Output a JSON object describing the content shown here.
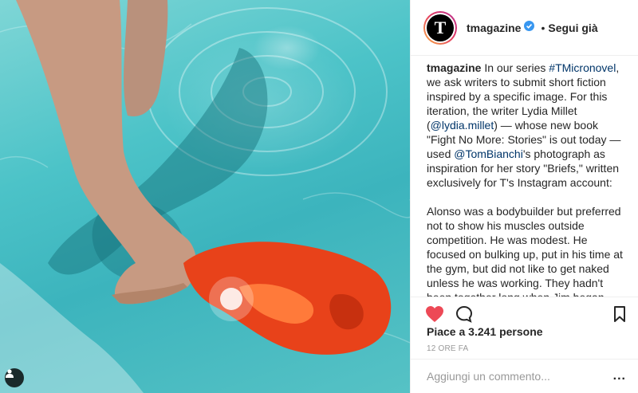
{
  "photo": {
    "alt_icon": "user-tag-icon"
  },
  "header": {
    "username": "tmagazine",
    "separator": "•",
    "follow_label": "Segui già",
    "avatar_letter": "T"
  },
  "caption": {
    "username": "tmagazine",
    "p1_a": " In our series ",
    "hashtag": "#TMicronovel",
    "p1_b": ", we ask writers to submit short fiction inspired by a specific image. For this iteration, the writer Lydia Millet (",
    "mention1": "@lydia.millet",
    "p1_c": ") — whose new book \"Fight No More: Stories\" is out today — used ",
    "mention2": "@TomBianchi",
    "p1_d": "'s photograph as inspiration for her story \"Briefs,\" written exclusively for T's Instagram account:",
    "p2": "Alonso was a bodybuilder but preferred not to show his muscles outside competition. He was modest. He focused on bulking up, put in his time at the gym, but did not like to get naked unless he was working. They hadn't been together long when Jim began trying to wean him of this unseemly modest streak. You know the saying about the tree that falls in the forest? he asked"
  },
  "actions": {
    "likes": "Piace a 3.241 persone",
    "time": "12 ORE FA"
  },
  "comment": {
    "placeholder": "Aggiungi un commento...",
    "more": "..."
  },
  "colors": {
    "link": "#003569",
    "heart": "#ed4956",
    "verified": "#3897f0"
  }
}
